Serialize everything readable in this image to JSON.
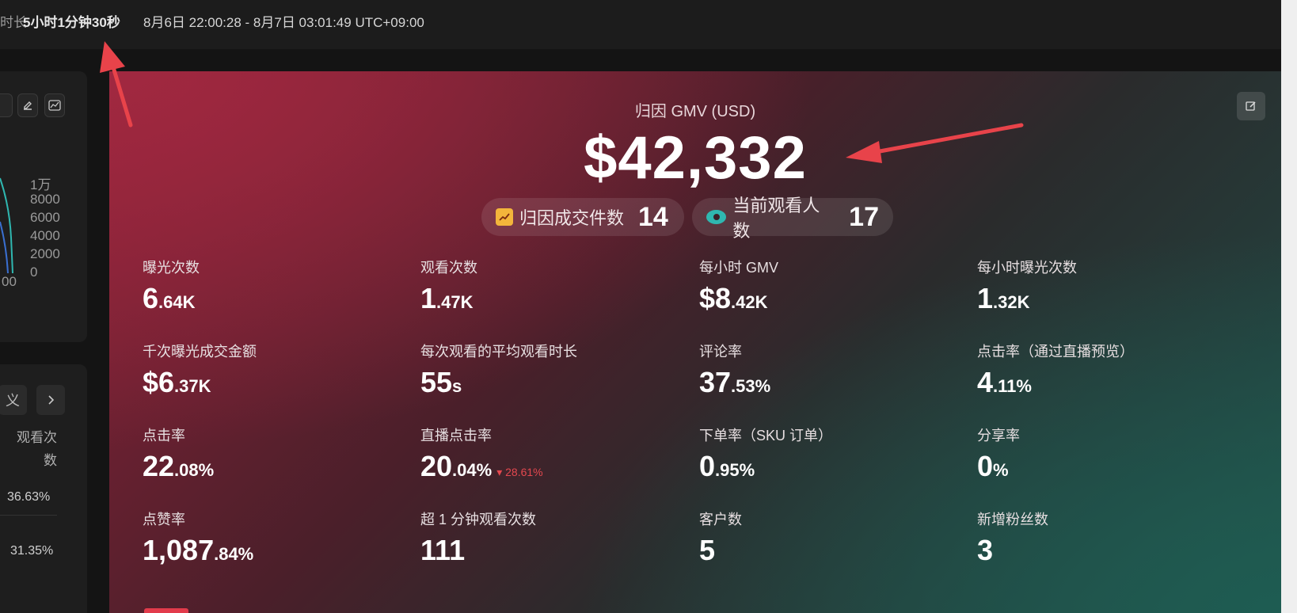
{
  "topbar": {
    "duration_label": "时长",
    "duration_value": "5小时1分钟30秒",
    "time_range": "8月6日 22:00:28 - 8月7日 03:01:49 UTC+09:00"
  },
  "left": {
    "y_axis_ticks": [
      "1万",
      "8000",
      "6000",
      "4000",
      "2000",
      "0"
    ],
    "x_tick": "00",
    "custom_button": "义",
    "next_icon": "chevron-right-icon",
    "column_header": "观看次数",
    "percentages": [
      "36.63%",
      "31.35%"
    ]
  },
  "card": {
    "gmv_title": "归因 GMV (USD)",
    "gmv_value": "$42,332",
    "pills": [
      {
        "label": "归因成交件数",
        "value": "14",
        "icon": "trend-icon"
      },
      {
        "label": "当前观看人数",
        "value": "17",
        "icon": "eye-icon"
      }
    ],
    "metrics": [
      {
        "label": "曝光次数",
        "big": "6",
        "small": ".64K"
      },
      {
        "label": "观看次数",
        "big": "1",
        "small": ".47K"
      },
      {
        "label": "每小时 GMV",
        "big": "$8",
        "small": ".42K"
      },
      {
        "label": "每小时曝光次数",
        "big": "1",
        "small": ".32K"
      },
      {
        "label": "千次曝光成交金额",
        "big": "$6",
        "small": ".37K"
      },
      {
        "label": "每次观看的平均观看时长",
        "big": "55",
        "small": "s"
      },
      {
        "label": "评论率",
        "big": "37",
        "small": ".53%"
      },
      {
        "label": "点击率（通过直播预览）",
        "big": "4",
        "small": ".11%"
      },
      {
        "label": "点击率",
        "big": "22",
        "small": ".08%"
      },
      {
        "label": "直播点击率",
        "big": "20",
        "small": ".04%",
        "delta": "▾ 28.61%"
      },
      {
        "label": "下单率（SKU 订单）",
        "big": "0",
        "small": ".95%"
      },
      {
        "label": "分享率",
        "big": "0",
        "small": "%"
      },
      {
        "label": "点赞率",
        "big": "1,087",
        "small": ".84%"
      },
      {
        "label": "超 1 分钟观看次数",
        "big": "111",
        "small": ""
      },
      {
        "label": "客户数",
        "big": "5",
        "small": ""
      },
      {
        "label": "新增粉丝数",
        "big": "3",
        "small": ""
      }
    ]
  },
  "colors": {
    "accent_red": "#e4484f",
    "arrow_red": "#e8434a",
    "card_top_left": "#a12840",
    "card_bottom_right": "#245248"
  }
}
